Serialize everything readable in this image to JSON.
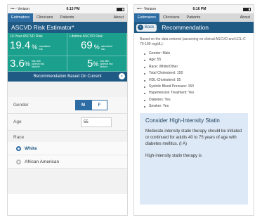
{
  "left": {
    "status": {
      "carrier": "•••◦◦ Verizon",
      "time": "6:15 PM"
    },
    "tabs": [
      "Estimators",
      "Clinicians",
      "Patients",
      "About"
    ],
    "title": "ASCVD Risk Estimator*",
    "risk": {
      "ten_year_label": "10-Year ASCVD Risk",
      "lifetime_label": "Lifetime ASCVD Risk",
      "ten_year_value": "19.4",
      "ten_year_unit": "%",
      "ten_year_note": "calculated risk",
      "lifetime_value": "69",
      "lifetime_unit": "%",
      "lifetime_note": "calculated risk",
      "optimal_ten_value": "3.6",
      "optimal_ten_unit": "%",
      "optimal_ten_note": "risk with optimal risk factors*",
      "optimal_life_value": "5",
      "optimal_life_unit": "%",
      "optimal_life_note": "risk with optimal risk factors"
    },
    "rec_button": "Recommendation Based On Current",
    "form": {
      "gender_label": "Gender",
      "gender_options": [
        "M",
        "F"
      ],
      "age_label": "Age",
      "age_value": "55",
      "race_label": "Race",
      "race_options": [
        "White",
        "African American"
      ]
    }
  },
  "right": {
    "status": {
      "carrier": "•••◦◦ Verizon",
      "time": "6:16 PM"
    },
    "tabs": [
      "Estimators",
      "Clinicians",
      "Patients",
      "About"
    ],
    "back_label": "Back",
    "title": "Recommendation",
    "intro": "Based on the data entered (assuming no clinical ASCVD and LDL-C 70-189 mg/dL):",
    "bullets": [
      "Gender: Male",
      "Age: 55",
      "Race: White/Other",
      "Total Cholesterol: 150",
      "HDL-Cholesterol: 55",
      "Systolic Blood Pressure: 150",
      "Hypertension Treatment: Yes",
      "Diabetes: Yes",
      "Smoker: Yes"
    ],
    "card_title": "Consider High-Intensity Statin",
    "card_body": "Moderate-intensity statin therapy should be initiated or continued for adults 40 to 75 years of age with diabetes mellitus. (I A)",
    "card_body2": "High-intensity statin therapy is"
  }
}
